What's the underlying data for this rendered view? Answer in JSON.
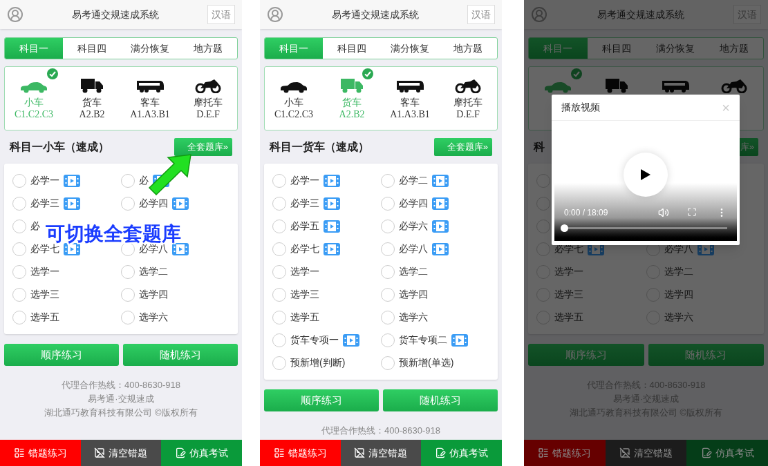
{
  "screens": [
    {
      "header": {
        "title": "易考通交规速成系统",
        "language_button": "汉语"
      },
      "tabs": [
        {
          "label": "科目一",
          "selected": true
        },
        {
          "label": "科目四",
          "selected": false
        },
        {
          "label": "满分恢复",
          "selected": false
        },
        {
          "label": "地方题",
          "selected": false
        }
      ],
      "vehicles": [
        {
          "kind": "car",
          "name": "小车",
          "code": "C1.C2.C3",
          "selected": true
        },
        {
          "kind": "truck",
          "name": "货车",
          "code": "A2.B2",
          "selected": false
        },
        {
          "kind": "bus",
          "name": "客车",
          "code": "A1.A3.B1",
          "selected": false
        },
        {
          "kind": "motorcycle",
          "name": "摩托车",
          "code": "D.E.F",
          "selected": false
        }
      ],
      "section": {
        "title": "科目一小车（速成）",
        "button": "全套题库»"
      },
      "items": [
        {
          "label": "必学一",
          "video": true,
          "covered": false,
          "checked": false
        },
        {
          "label": "必",
          "video": true,
          "covered": false,
          "checked": false
        },
        {
          "label": "必学三",
          "video": true,
          "covered": false,
          "checked": false
        },
        {
          "label": "必学四",
          "video": true,
          "covered": false,
          "checked": false
        },
        {
          "label": "必",
          "video": false,
          "covered": false,
          "checked": false
        },
        {
          "covered": true
        },
        {
          "label": "必学七",
          "video": true,
          "covered": false,
          "checked": false
        },
        {
          "label": "必学八",
          "video": true,
          "covered": false,
          "checked": false
        },
        {
          "label": "选学一",
          "video": false,
          "covered": false,
          "checked": false
        },
        {
          "label": "选学二",
          "video": false,
          "covered": false,
          "checked": false
        },
        {
          "label": "选学三",
          "video": false,
          "covered": false,
          "checked": false
        },
        {
          "label": "选学四",
          "video": false,
          "covered": false,
          "checked": false
        },
        {
          "label": "选学五",
          "video": false,
          "covered": false,
          "checked": false
        },
        {
          "label": "选学六",
          "video": false,
          "covered": false,
          "checked": false
        }
      ],
      "buttons": [
        "顺序练习",
        "随机练习"
      ],
      "footer": [
        "代理合作热线：400-8630-918",
        "易考通·交规速成",
        "湖北通巧教育科技有限公司 ©版权所有"
      ],
      "bottom_bar": [
        {
          "kind": "list",
          "label": "错题练习",
          "color": "#ff0000"
        },
        {
          "kind": "image",
          "label": "清空错题",
          "color": "#4a4a4a"
        },
        {
          "kind": "edit",
          "label": "仿真考试",
          "color": "#0a9a3a"
        }
      ],
      "annotation": {
        "caption": "可切换全套题库"
      }
    },
    {
      "header": {
        "title": "易考通交规速成系统",
        "language_button": "汉语"
      },
      "tabs": [
        {
          "label": "科目一",
          "selected": true
        },
        {
          "label": "科目四",
          "selected": false
        },
        {
          "label": "满分恢复",
          "selected": false
        },
        {
          "label": "地方题",
          "selected": false
        }
      ],
      "vehicles": [
        {
          "kind": "car",
          "name": "小车",
          "code": "C1.C2.C3",
          "selected": false
        },
        {
          "kind": "truck",
          "name": "货车",
          "code": "A2.B2",
          "selected": true
        },
        {
          "kind": "bus",
          "name": "客车",
          "code": "A1.A3.B1",
          "selected": false
        },
        {
          "kind": "motorcycle",
          "name": "摩托车",
          "code": "D.E.F",
          "selected": false
        }
      ],
      "section": {
        "title": "科目一货车（速成）",
        "button": "全套题库»"
      },
      "items": [
        {
          "label": "必学一",
          "video": true,
          "covered": false,
          "checked": false
        },
        {
          "label": "必学二",
          "video": true,
          "covered": false,
          "checked": false
        },
        {
          "label": "必学三",
          "video": true,
          "covered": false,
          "checked": false
        },
        {
          "label": "必学四",
          "video": true,
          "covered": false,
          "checked": false
        },
        {
          "label": "必学五",
          "video": true,
          "covered": false,
          "checked": false
        },
        {
          "label": "必学六",
          "video": true,
          "covered": false,
          "checked": false
        },
        {
          "label": "必学七",
          "video": true,
          "covered": false,
          "checked": false
        },
        {
          "label": "必学八",
          "video": true,
          "covered": false,
          "checked": false
        },
        {
          "label": "选学一",
          "video": false,
          "covered": false,
          "checked": false
        },
        {
          "label": "选学二",
          "video": false,
          "covered": false,
          "checked": false
        },
        {
          "label": "选学三",
          "video": false,
          "covered": false,
          "checked": false
        },
        {
          "label": "选学四",
          "video": false,
          "covered": false,
          "checked": false
        },
        {
          "label": "选学五",
          "video": false,
          "covered": false,
          "checked": false
        },
        {
          "label": "选学六",
          "video": false,
          "covered": false,
          "checked": false
        },
        {
          "label": "货车专项一",
          "video": true,
          "covered": false,
          "checked": false
        },
        {
          "label": "货车专项二",
          "video": true,
          "covered": false,
          "checked": false
        },
        {
          "label": "预新增(判断)",
          "video": false,
          "covered": false,
          "checked": false
        },
        {
          "label": "预新增(单选)",
          "video": false,
          "covered": false,
          "checked": false
        }
      ],
      "buttons": [
        "顺序练习",
        "随机练习"
      ],
      "footer": [
        "代理合作热线：400-8630-918"
      ],
      "bottom_bar": [
        {
          "kind": "list",
          "label": "错题练习",
          "color": "#ff0000"
        },
        {
          "kind": "image",
          "label": "清空错题",
          "color": "#4a4a4a"
        },
        {
          "kind": "edit",
          "label": "仿真考试",
          "color": "#0a9a3a"
        }
      ]
    },
    {
      "header": {
        "title": "易考通交规速成系统",
        "language_button": "汉语"
      },
      "tabs": [
        {
          "label": "科目一",
          "selected": true
        },
        {
          "label": "科目四",
          "selected": false
        },
        {
          "label": "满分恢复",
          "selected": false
        },
        {
          "label": "地方题",
          "selected": false
        }
      ],
      "vehicles": [
        {
          "kind": "car",
          "selected": true
        },
        {
          "kind": "truck",
          "selected": false
        },
        {
          "kind": "bus",
          "selected": false
        },
        {
          "kind": "motorcycle",
          "selected": false
        }
      ],
      "section": {
        "title": "科",
        "button": "库»"
      },
      "items": [
        {
          "covered": true,
          "checked": false
        },
        {
          "covered": true
        },
        {
          "covered": true,
          "checked": false
        },
        {
          "covered": true
        },
        {
          "covered": true,
          "checked": false
        },
        {
          "covered": true
        },
        {
          "label": "必学七",
          "video": true,
          "covered": false,
          "checked": false
        },
        {
          "label": "必学八",
          "video": true,
          "covered": false,
          "checked": false
        },
        {
          "label": "选学一",
          "video": false,
          "covered": false,
          "checked": false
        },
        {
          "label": "选学二",
          "video": false,
          "covered": false,
          "checked": false
        },
        {
          "label": "选学三",
          "video": false,
          "covered": false,
          "checked": false
        },
        {
          "label": "选学四",
          "video": false,
          "covered": false,
          "checked": false
        },
        {
          "label": "选学五",
          "video": false,
          "covered": false,
          "checked": false
        },
        {
          "label": "选学六",
          "video": false,
          "covered": false,
          "checked": false
        }
      ],
      "buttons": [
        "顺序练习",
        "随机练习"
      ],
      "footer": [
        "代理合作热线：400-8630-918",
        "易考通·交规速成",
        "湖北通巧教育科技有限公司 ©版权所有"
      ],
      "bottom_bar": [
        {
          "kind": "list",
          "label": "错题练习",
          "color": "#660000"
        },
        {
          "kind": "image",
          "label": "清空错题",
          "color": "#1c1c1c"
        },
        {
          "kind": "edit",
          "label": "仿真考试",
          "color": "#053d18"
        }
      ],
      "dialog": {
        "title": "播放视频",
        "close": "×",
        "time": "0:00 / 18:09",
        "level": 0
      }
    }
  ]
}
